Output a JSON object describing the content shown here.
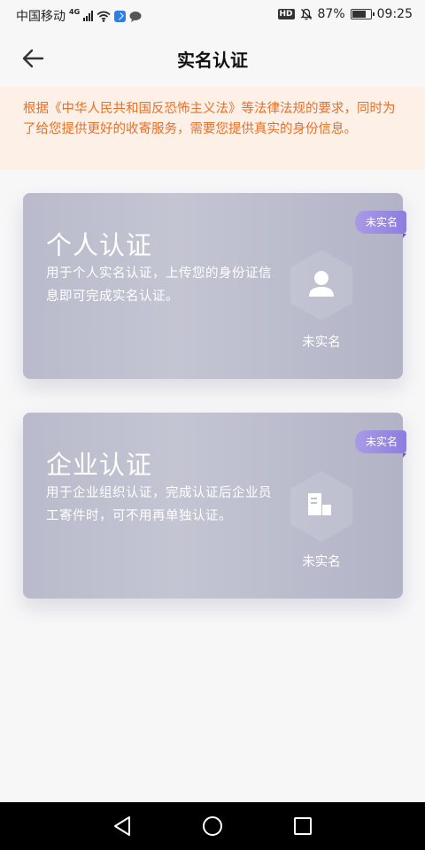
{
  "status_bar": {
    "carrier": "中国移动",
    "network": "4G",
    "hd": "HD",
    "battery": "87%",
    "battery_level": 0.87,
    "time": "09:25"
  },
  "header": {
    "title": "实名认证",
    "back_icon": "arrow-left-icon"
  },
  "notice": {
    "text": "根据《中华人民共和国反恐怖主义法》等法律法规的要求，同时为了给您提供更好的收寄服务，需要您提供真实的身份信息。"
  },
  "cards": [
    {
      "title": "个人认证",
      "description": "用于个人实名认证，上传您的身份证信息即可完成实名认证。",
      "ribbon": "未实名",
      "status": "未实名",
      "icon": "person-icon"
    },
    {
      "title": "企业认证",
      "description": "用于企业组织认证，完成认证后企业员工寄件时，可不用再单独认证。",
      "ribbon": "未实名",
      "status": "未实名",
      "icon": "building-icon"
    }
  ],
  "nav": {
    "back_icon": "triangle-back-icon",
    "home_icon": "circle-home-icon",
    "recents_icon": "square-recents-icon"
  },
  "colors": {
    "notice_bg": "#fdf0e6",
    "notice_text": "#e8702a",
    "ribbon": "#9a8be3",
    "card": "#bdbecf"
  }
}
